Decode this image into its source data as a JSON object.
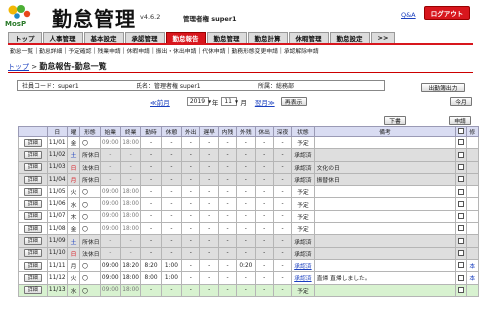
{
  "header": {
    "logo_text": "MosP",
    "app_title": "勤怠管理",
    "version": "v4.6.2",
    "user": "管理者権 super1",
    "qa_label": "Q&A",
    "logout_label": "ログアウト"
  },
  "main_tabs": [
    {
      "label": "トップ",
      "active": false
    },
    {
      "label": "人事管理",
      "active": false
    },
    {
      "label": "基本設定",
      "active": false
    },
    {
      "label": "承認管理",
      "active": false
    },
    {
      "label": "勤怠報告",
      "active": true
    },
    {
      "label": "勤怠管理",
      "active": false
    },
    {
      "label": "勤怠計算",
      "active": false
    },
    {
      "label": "休暇管理",
      "active": false
    },
    {
      "label": "勤怠設定",
      "active": false
    },
    {
      "label": ">>",
      "active": false
    }
  ],
  "sub_menu": [
    "勤怠一覧",
    "勤怠詳細",
    "予定確認",
    "残業申請",
    "休暇申請",
    "振出・休出申請",
    "代休申請",
    "勤務形態変更申請",
    "承認解除申請"
  ],
  "breadcrumb": {
    "top": "トップ",
    "current": "勤怠報告-勤怠一覧"
  },
  "employee": {
    "code": "社員コード：super1",
    "name": "氏名：管理者権 super1",
    "dept": "所属：総務部"
  },
  "buttons": {
    "output_calendar": "出勤簿出力",
    "this_month": "今月",
    "search": "再表示",
    "down": "下書",
    "apply": "申請"
  },
  "month_nav": {
    "prev": "≪前月",
    "year": "2019",
    "year_unit": "年",
    "month": "11",
    "month_unit": "月",
    "next": "翌月≫"
  },
  "table": {
    "headers": [
      "",
      "日",
      "曜",
      "形態",
      "始業",
      "終業",
      "勤時",
      "休憩",
      "外出",
      "遅早",
      "内残",
      "外残",
      "休出",
      "深夜",
      "状態",
      "備考",
      "",
      "修"
    ],
    "detail_label": "詳細",
    "rows": [
      {
        "date": "11/01",
        "dow": "金",
        "dowc": "",
        "kind": "〇",
        "start": "09:00",
        "end": "18:00",
        "work": "-",
        "rest": "-",
        "out": "-",
        "late": "-",
        "in_ot": "-",
        "ex_ot": "-",
        "hol": "-",
        "night": "-",
        "status": "予定",
        "status_link": false,
        "note": "",
        "fix": "",
        "bg": "white"
      },
      {
        "date": "11/02",
        "dow": "土",
        "dowc": "blue",
        "kind": "所休日",
        "start": "-",
        "end": "-",
        "work": "-",
        "rest": "-",
        "out": "-",
        "late": "-",
        "in_ot": "-",
        "ex_ot": "-",
        "hol": "-",
        "night": "-",
        "status": "承認済",
        "status_link": false,
        "note": "",
        "fix": "",
        "bg": "gray"
      },
      {
        "date": "11/03",
        "dow": "日",
        "dowc": "red",
        "kind": "法休日",
        "start": "-",
        "end": "-",
        "work": "-",
        "rest": "-",
        "out": "-",
        "late": "-",
        "in_ot": "-",
        "ex_ot": "-",
        "hol": "-",
        "night": "-",
        "status": "承認済",
        "status_link": false,
        "note": "文化の日",
        "fix": "",
        "bg": "gray"
      },
      {
        "date": "11/04",
        "dow": "月",
        "dowc": "red",
        "kind": "所休日",
        "start": "-",
        "end": "-",
        "work": "-",
        "rest": "-",
        "out": "-",
        "late": "-",
        "in_ot": "-",
        "ex_ot": "-",
        "hol": "-",
        "night": "-",
        "status": "承認済",
        "status_link": false,
        "note": "振替休日",
        "fix": "",
        "bg": "gray"
      },
      {
        "date": "11/05",
        "dow": "火",
        "dowc": "",
        "kind": "〇",
        "start": "09:00",
        "end": "18:00",
        "work": "-",
        "rest": "-",
        "out": "-",
        "late": "-",
        "in_ot": "-",
        "ex_ot": "-",
        "hol": "-",
        "night": "-",
        "status": "予定",
        "status_link": false,
        "note": "",
        "fix": "",
        "bg": "white"
      },
      {
        "date": "11/06",
        "dow": "水",
        "dowc": "",
        "kind": "〇",
        "start": "09:00",
        "end": "18:00",
        "work": "-",
        "rest": "-",
        "out": "-",
        "late": "-",
        "in_ot": "-",
        "ex_ot": "-",
        "hol": "-",
        "night": "-",
        "status": "予定",
        "status_link": false,
        "note": "",
        "fix": "",
        "bg": "white"
      },
      {
        "date": "11/07",
        "dow": "木",
        "dowc": "",
        "kind": "〇",
        "start": "09:00",
        "end": "18:00",
        "work": "-",
        "rest": "-",
        "out": "-",
        "late": "-",
        "in_ot": "-",
        "ex_ot": "-",
        "hol": "-",
        "night": "-",
        "status": "予定",
        "status_link": false,
        "note": "",
        "fix": "",
        "bg": "white"
      },
      {
        "date": "11/08",
        "dow": "金",
        "dowc": "",
        "kind": "〇",
        "start": "09:00",
        "end": "18:00",
        "work": "-",
        "rest": "-",
        "out": "-",
        "late": "-",
        "in_ot": "-",
        "ex_ot": "-",
        "hol": "-",
        "night": "-",
        "status": "予定",
        "status_link": false,
        "note": "",
        "fix": "",
        "bg": "white"
      },
      {
        "date": "11/09",
        "dow": "土",
        "dowc": "blue",
        "kind": "所休日",
        "start": "-",
        "end": "-",
        "work": "-",
        "rest": "-",
        "out": "-",
        "late": "-",
        "in_ot": "-",
        "ex_ot": "-",
        "hol": "-",
        "night": "-",
        "status": "承認済",
        "status_link": false,
        "note": "",
        "fix": "",
        "bg": "gray"
      },
      {
        "date": "11/10",
        "dow": "日",
        "dowc": "red",
        "kind": "法休日",
        "start": "-",
        "end": "-",
        "work": "-",
        "rest": "-",
        "out": "-",
        "late": "-",
        "in_ot": "-",
        "ex_ot": "-",
        "hol": "-",
        "night": "-",
        "status": "承認済",
        "status_link": false,
        "note": "",
        "fix": "",
        "bg": "gray"
      },
      {
        "date": "11/11",
        "dow": "月",
        "dowc": "",
        "kind": "〇",
        "start": "09:00",
        "end": "18:20",
        "work": "8:20",
        "rest": "1:00",
        "out": "-",
        "late": "-",
        "in_ot": "-",
        "ex_ot": "0:20",
        "hol": "-",
        "night": "-",
        "status": "承認済",
        "status_link": true,
        "note": "",
        "fix": "本",
        "bg": "white"
      },
      {
        "date": "11/12",
        "dow": "火",
        "dowc": "",
        "kind": "〇",
        "start": "09:00",
        "end": "18:00",
        "work": "8:00",
        "rest": "1:00",
        "out": "-",
        "late": "-",
        "in_ot": "-",
        "ex_ot": "-",
        "hol": "-",
        "night": "-",
        "status": "承認済",
        "status_link": true,
        "note": "直帰 直帰しました。",
        "fix": "本",
        "bg": "white"
      },
      {
        "date": "11/13",
        "dow": "水",
        "dowc": "",
        "kind": "〇",
        "start": "09:00",
        "end": "18:00",
        "work": "-",
        "rest": "-",
        "out": "-",
        "late": "-",
        "in_ot": "-",
        "ex_ot": "-",
        "hol": "-",
        "night": "-",
        "status": "予定",
        "status_link": false,
        "note": "",
        "fix": "",
        "bg": "green"
      }
    ]
  },
  "colors": {
    "accent": "#d8161d",
    "header_row": "#d9dcf2",
    "holiday_row": "#dedede",
    "today_row": "#d8f2d0"
  }
}
